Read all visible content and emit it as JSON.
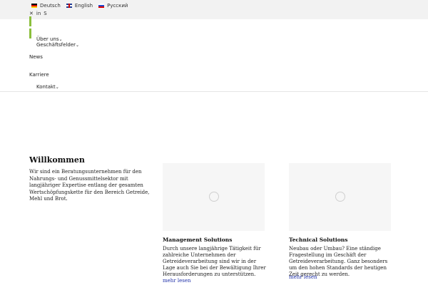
{
  "languages": [
    {
      "label": "Deutsch"
    },
    {
      "label": "English"
    },
    {
      "label": "Русский"
    }
  ],
  "social": {
    "xing": "✕",
    "linkedin": "in",
    "skype": "S"
  },
  "nav": {
    "ueber_uns": "Über uns",
    "geschaeftsfelder": "Geschäftsfelder",
    "news": "News",
    "karriere": "Karriere",
    "kontakt": "Kontakt",
    "caret": "⌄"
  },
  "welcome": {
    "title": "Willkommen",
    "text": "Wir sind ein Beratungsunternehmen für den Nahrungs- und Genussmittelsektor mit langjähriger Expertise entlang der gesamten Wertschöpfungskette für den Bereich Getreide, Mehl und Brot."
  },
  "cards": [
    {
      "title": "Management Solutions",
      "text": "Durch unsere langjährige Tätigkeit für zahlreiche Unternehmen der Getreideverarbeitung sind wir in der Lage auch Sie bei der Bewältigung Ihrer Herausforderungen zu unterstützen.",
      "link": "mehr lesen"
    },
    {
      "title": "Technical Solutions",
      "text": "Neubau oder Umbau? Eine ständige Fragestellung im Geschäft der Getreideverarbeitung. Ganz besonders um den hohen Standards der heutigen Zeit gerecht zu werden.",
      "link": "mehr lesen"
    }
  ],
  "colors": {
    "accent_green": "#8bbf3c",
    "link_blue": "#2233aa"
  }
}
